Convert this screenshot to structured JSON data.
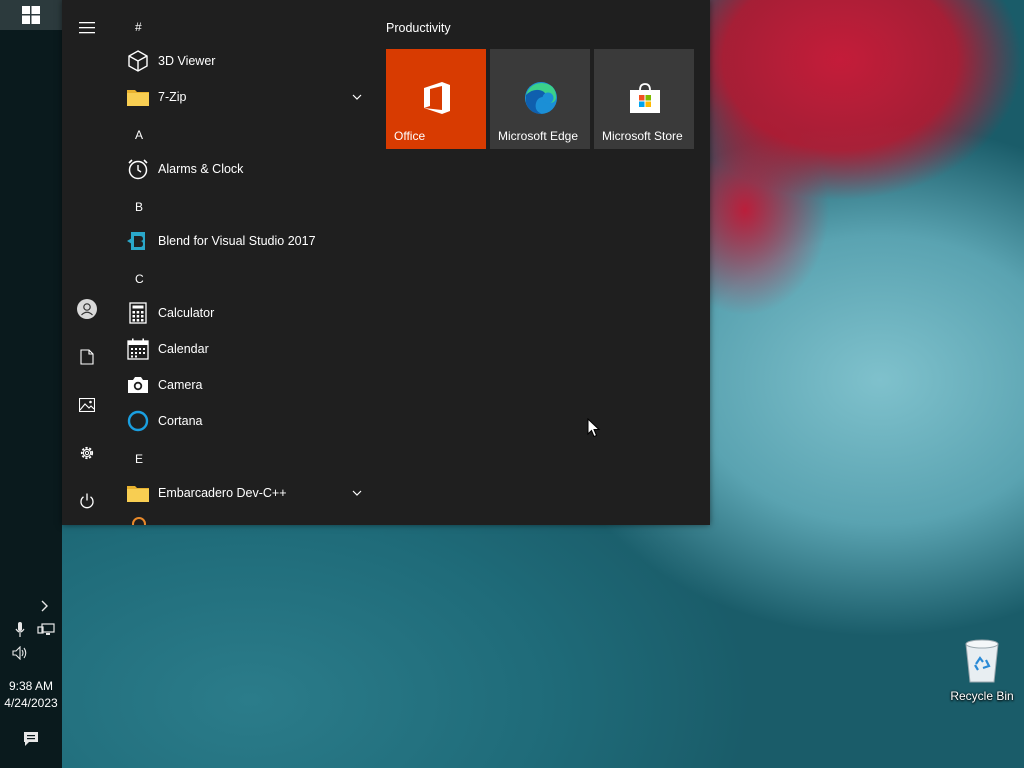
{
  "taskbar": {
    "time": "9:38 AM",
    "date": "4/24/2023"
  },
  "start_menu": {
    "menu_icon": "hamburger-icon",
    "rail_icons": [
      "user-icon",
      "documents-icon",
      "pictures-icon",
      "settings-icon",
      "power-icon"
    ],
    "app_list": {
      "letters": {
        "hash": "#",
        "a": "A",
        "b": "B",
        "c": "C",
        "e": "E"
      },
      "apps": {
        "viewer3d": "3D Viewer",
        "zip": "7-Zip",
        "alarms": "Alarms & Clock",
        "blend": "Blend for Visual Studio 2017",
        "calculator": "Calculator",
        "calendar": "Calendar",
        "camera": "Camera",
        "cortana": "Cortana",
        "embarcadero": "Embarcadero Dev-C++"
      }
    },
    "tiles": {
      "group_title": "Productivity",
      "office": "Office",
      "edge": "Microsoft Edge",
      "store": "Microsoft Store"
    }
  },
  "desktop": {
    "recycle_bin": "Recycle Bin"
  },
  "colors": {
    "office_tile": "#d83b01",
    "tile_gray": "#3a3a3a",
    "menu_bg": "#1f1f1f",
    "taskbar_bg": "#0a1a1d"
  }
}
